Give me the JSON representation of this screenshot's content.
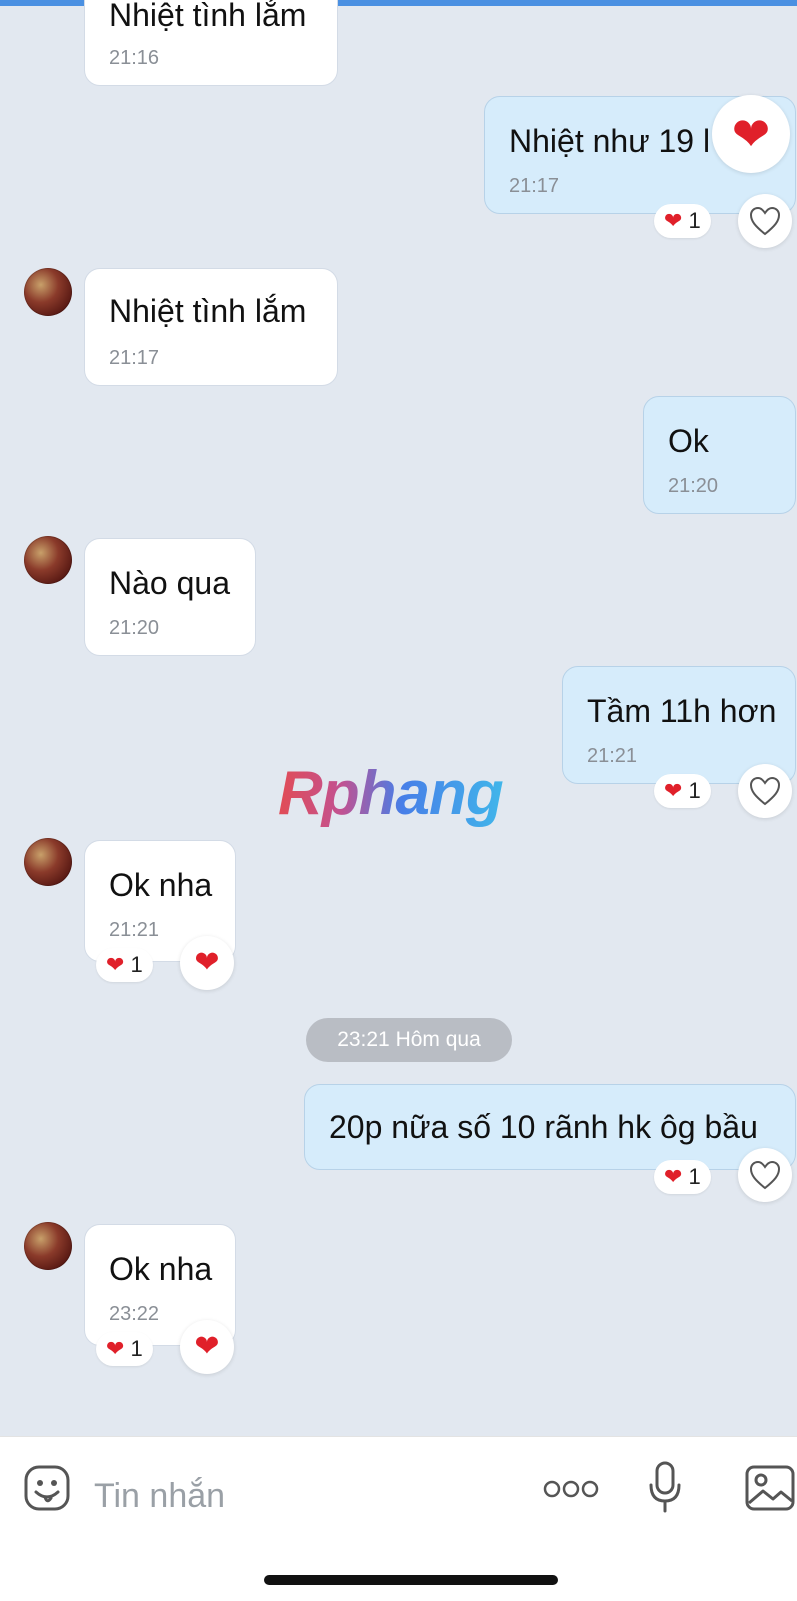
{
  "messages": [
    {
      "side": "in",
      "text": "Nhiệt tình lắm",
      "time": "21:16"
    },
    {
      "side": "out",
      "text": "Nhiệt như 19 l",
      "time": "21:17",
      "reaction_count": "1"
    },
    {
      "side": "in",
      "text": "Nhiệt tình lắm",
      "time": "21:17"
    },
    {
      "side": "out",
      "text": "Ok",
      "time": "21:20"
    },
    {
      "side": "in",
      "text": "Nào qua",
      "time": "21:20"
    },
    {
      "side": "out",
      "text": "Tầm 11h hơn",
      "time": "21:21",
      "reaction_count": "1"
    },
    {
      "side": "in",
      "text": "Ok nha",
      "time": "21:21",
      "reaction_count": "1"
    },
    {
      "side": "out",
      "text": "20p nữa số 10 rãnh hk ôg bầu",
      "reaction_count": "1"
    },
    {
      "side": "in",
      "text": "Ok nha",
      "time": "23:22",
      "reaction_count": "1"
    }
  ],
  "date_separator": "23:21 Hôm qua",
  "watermark": "Rphang",
  "input": {
    "placeholder": "Tin nhắn",
    "icons": [
      "sticker-icon",
      "more-icon",
      "microphone-icon",
      "image-icon"
    ]
  },
  "colors": {
    "outgoing_bubble": "#d6ecfb",
    "incoming_bubble": "#ffffff",
    "heart": "#e0202a",
    "background": "#e2e8f0"
  }
}
